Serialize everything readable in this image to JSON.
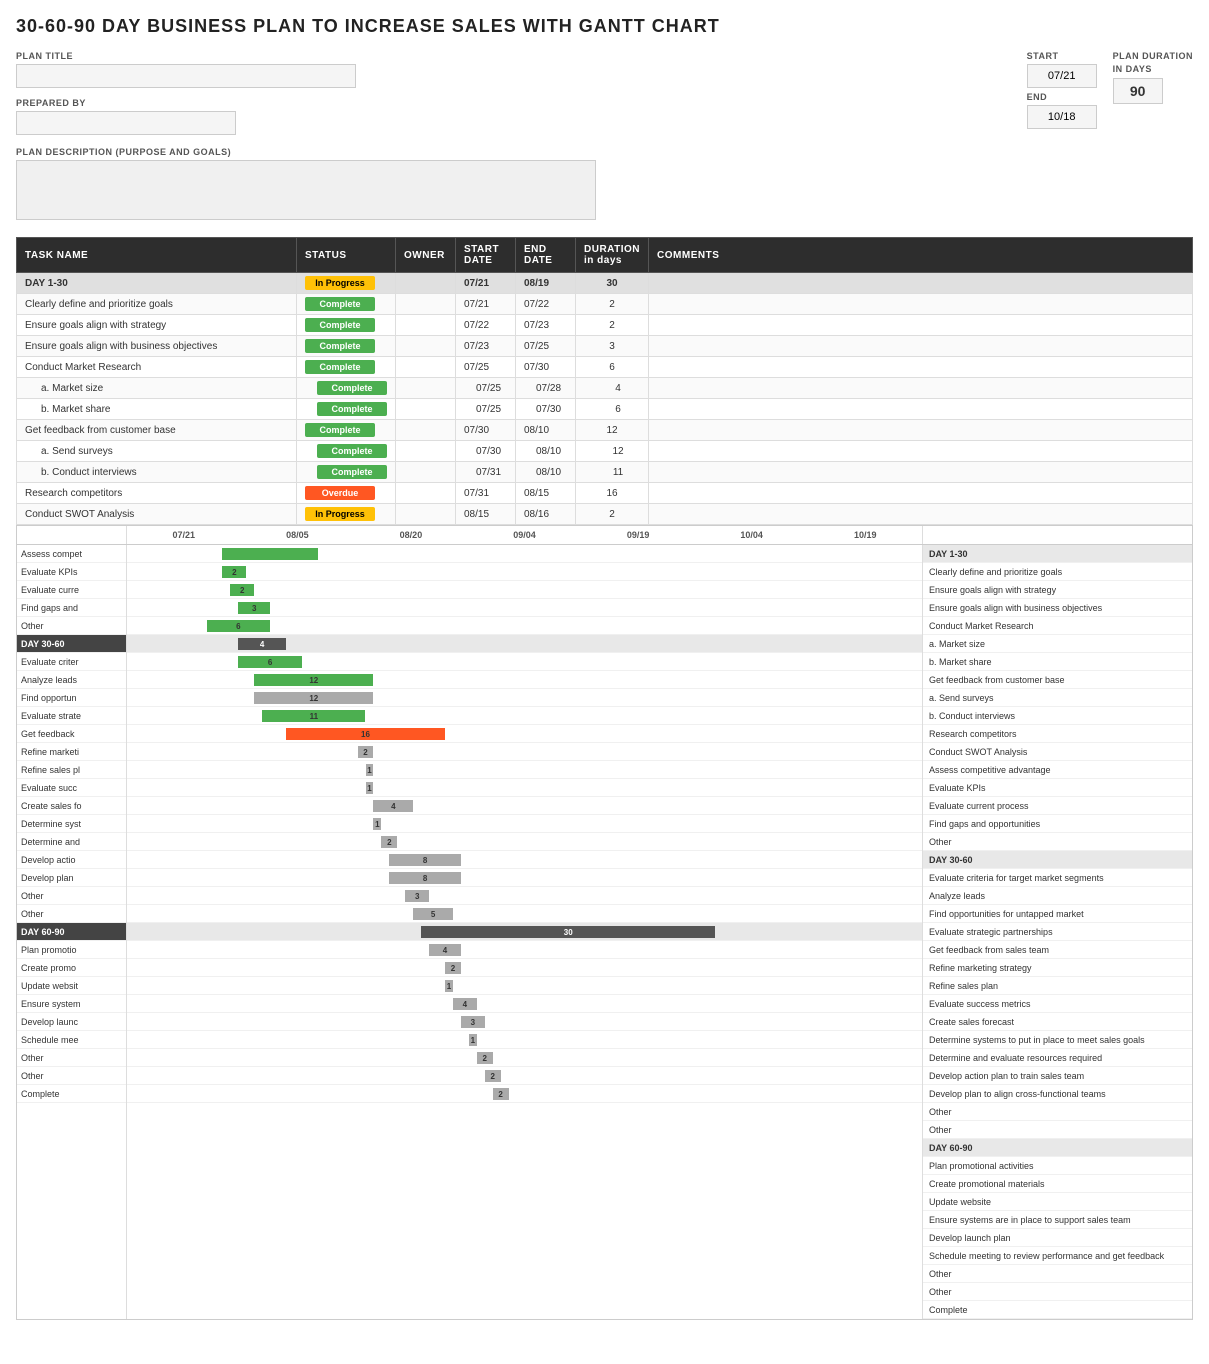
{
  "title": "30-60-90 DAY BUSINESS PLAN TO INCREASE SALES WITH GANTT CHART",
  "form": {
    "plan_title_label": "PLAN TITLE",
    "plan_title_value": "",
    "prepared_by_label": "PREPARED BY",
    "prepared_by_value": "",
    "start_label": "START",
    "start_value": "07/21",
    "end_label": "END",
    "end_value": "10/18",
    "plan_duration_label": "PLAN DURATION",
    "plan_duration_unit": "in days",
    "plan_duration_value": "90",
    "description_label": "PLAN DESCRIPTION (PURPOSE AND GOALS)",
    "description_value": ""
  },
  "table_headers": {
    "task_name": "TASK NAME",
    "status": "STATUS",
    "owner": "OWNER",
    "start_date": "START DATE",
    "end_date": "END DATE",
    "duration": "DURATION in days",
    "comments": "COMMENTS"
  },
  "tasks": [
    {
      "name": "DAY 1-30",
      "status": "In Progress",
      "status_type": "inprogress",
      "owner": "",
      "start": "07/21",
      "end": "08/19",
      "duration": "30",
      "comments": "",
      "level": "day"
    },
    {
      "name": "Clearly define and prioritize goals",
      "status": "Complete",
      "status_type": "complete",
      "owner": "",
      "start": "07/21",
      "end": "07/22",
      "duration": "2",
      "comments": "",
      "level": "task"
    },
    {
      "name": "Ensure goals align with strategy",
      "status": "Complete",
      "status_type": "complete",
      "owner": "",
      "start": "07/22",
      "end": "07/23",
      "duration": "2",
      "comments": "",
      "level": "task"
    },
    {
      "name": "Ensure goals align with business objectives",
      "status": "Complete",
      "status_type": "complete",
      "owner": "",
      "start": "07/23",
      "end": "07/25",
      "duration": "3",
      "comments": "",
      "level": "task"
    },
    {
      "name": "Conduct Market Research",
      "status": "Complete",
      "status_type": "complete",
      "owner": "",
      "start": "07/25",
      "end": "07/30",
      "duration": "6",
      "comments": "",
      "level": "task"
    },
    {
      "name": "a. Market size",
      "status": "Complete",
      "status_type": "complete",
      "owner": "",
      "start": "07/25",
      "end": "07/28",
      "duration": "4",
      "comments": "",
      "level": "sub"
    },
    {
      "name": "b. Market share",
      "status": "Complete",
      "status_type": "complete",
      "owner": "",
      "start": "07/25",
      "end": "07/30",
      "duration": "6",
      "comments": "",
      "level": "sub"
    },
    {
      "name": "Get feedback from customer base",
      "status": "Complete",
      "status_type": "complete",
      "owner": "",
      "start": "07/30",
      "end": "08/10",
      "duration": "12",
      "comments": "",
      "level": "task"
    },
    {
      "name": "a. Send surveys",
      "status": "Complete",
      "status_type": "complete",
      "owner": "",
      "start": "07/30",
      "end": "08/10",
      "duration": "12",
      "comments": "",
      "level": "sub"
    },
    {
      "name": "b. Conduct interviews",
      "status": "Complete",
      "status_type": "complete",
      "owner": "",
      "start": "07/31",
      "end": "08/10",
      "duration": "11",
      "comments": "",
      "level": "sub"
    },
    {
      "name": "Research competitors",
      "status": "Overdue",
      "status_type": "overdue",
      "owner": "",
      "start": "07/31",
      "end": "08/15",
      "duration": "16",
      "comments": "",
      "level": "task"
    },
    {
      "name": "Conduct SWOT Analysis",
      "status": "In Progress",
      "status_type": "inprogress",
      "owner": "",
      "start": "08/15",
      "end": "08/16",
      "duration": "2",
      "comments": "",
      "level": "task"
    }
  ],
  "gantt": {
    "time_labels": [
      "07/21",
      "08/05",
      "08/20",
      "09/04",
      "09/19",
      "10/04",
      "10/19"
    ],
    "rows": [
      {
        "label": "Assess compet",
        "type": "task",
        "bar_start_pct": 12,
        "bar_width_pct": 12,
        "bar_value": null,
        "bar_type": "complete"
      },
      {
        "label": "Evaluate KPIs",
        "type": "task",
        "bar_start_pct": 12,
        "bar_width_pct": 3,
        "bar_value": "2",
        "bar_type": "complete"
      },
      {
        "label": "Evaluate curre",
        "type": "task",
        "bar_start_pct": 13,
        "bar_width_pct": 3,
        "bar_value": "2",
        "bar_type": "complete"
      },
      {
        "label": "Find gaps and",
        "type": "task",
        "bar_start_pct": 14,
        "bar_width_pct": 4,
        "bar_value": "3",
        "bar_type": "complete"
      },
      {
        "label": "Other",
        "type": "task",
        "bar_start_pct": 10,
        "bar_width_pct": 8,
        "bar_value": "6",
        "bar_type": "complete"
      },
      {
        "label": "DAY 30-60",
        "type": "day",
        "bar_start_pct": 14,
        "bar_width_pct": 6,
        "bar_value": "4",
        "bar_type": "day"
      },
      {
        "label": "Evaluate criter",
        "type": "task",
        "bar_start_pct": 14,
        "bar_width_pct": 8,
        "bar_value": "6",
        "bar_type": "complete"
      },
      {
        "label": "Analyze leads",
        "type": "task",
        "bar_start_pct": 16,
        "bar_width_pct": 15,
        "bar_value": "12",
        "bar_type": "complete"
      },
      {
        "label": "Find opportun",
        "type": "task",
        "bar_start_pct": 16,
        "bar_width_pct": 15,
        "bar_value": "12",
        "bar_type": "inprogress"
      },
      {
        "label": "Evaluate strate",
        "type": "task",
        "bar_start_pct": 17,
        "bar_width_pct": 13,
        "bar_value": "11",
        "bar_type": "complete"
      },
      {
        "label": "Get feedback",
        "type": "task",
        "bar_start_pct": 20,
        "bar_width_pct": 20,
        "bar_value": "16",
        "bar_type": "overdue"
      },
      {
        "label": "Refine marketi",
        "type": "task",
        "bar_start_pct": 29,
        "bar_width_pct": 2,
        "bar_value": "2",
        "bar_type": "inprogress"
      },
      {
        "label": "Refine sales pl",
        "type": "task",
        "bar_start_pct": 30,
        "bar_width_pct": 1,
        "bar_value": "1",
        "bar_type": "inprogress"
      },
      {
        "label": "Evaluate succ",
        "type": "task",
        "bar_start_pct": 30,
        "bar_width_pct": 1,
        "bar_value": "1",
        "bar_type": "inprogress"
      },
      {
        "label": "Create sales fo",
        "type": "task",
        "bar_start_pct": 31,
        "bar_width_pct": 5,
        "bar_value": "4",
        "bar_type": "inprogress"
      },
      {
        "label": "Determine syst",
        "type": "task",
        "bar_start_pct": 31,
        "bar_width_pct": 1,
        "bar_value": "1",
        "bar_type": "inprogress"
      },
      {
        "label": "Determine and",
        "type": "task",
        "bar_start_pct": 32,
        "bar_width_pct": 2,
        "bar_value": "2",
        "bar_type": "inprogress"
      },
      {
        "label": "Develop actio",
        "type": "task",
        "bar_start_pct": 33,
        "bar_width_pct": 9,
        "bar_value": "8",
        "bar_type": "inprogress"
      },
      {
        "label": "Develop plan",
        "type": "task",
        "bar_start_pct": 33,
        "bar_width_pct": 9,
        "bar_value": "8",
        "bar_type": "inprogress"
      },
      {
        "label": "Other",
        "type": "task",
        "bar_start_pct": 35,
        "bar_width_pct": 3,
        "bar_value": "3",
        "bar_type": "inprogress"
      },
      {
        "label": "Other",
        "type": "task",
        "bar_start_pct": 36,
        "bar_width_pct": 5,
        "bar_value": "5",
        "bar_type": "inprogress"
      },
      {
        "label": "DAY 60-90",
        "type": "day",
        "bar_start_pct": 37,
        "bar_width_pct": 37,
        "bar_value": "30",
        "bar_type": "day"
      },
      {
        "label": "Plan promotio",
        "type": "task",
        "bar_start_pct": 38,
        "bar_width_pct": 4,
        "bar_value": "4",
        "bar_type": "inprogress"
      },
      {
        "label": "Create promo",
        "type": "task",
        "bar_start_pct": 40,
        "bar_width_pct": 2,
        "bar_value": "2",
        "bar_type": "inprogress"
      },
      {
        "label": "Update websit",
        "type": "task",
        "bar_start_pct": 40,
        "bar_width_pct": 1,
        "bar_value": "1",
        "bar_type": "inprogress"
      },
      {
        "label": "Ensure system",
        "type": "task",
        "bar_start_pct": 41,
        "bar_width_pct": 3,
        "bar_value": "4",
        "bar_type": "inprogress"
      },
      {
        "label": "Develop launc",
        "type": "task",
        "bar_start_pct": 42,
        "bar_width_pct": 3,
        "bar_value": "3",
        "bar_type": "inprogress"
      },
      {
        "label": "Schedule mee",
        "type": "task",
        "bar_start_pct": 43,
        "bar_width_pct": 1,
        "bar_value": "1",
        "bar_type": "inprogress"
      },
      {
        "label": "Other",
        "type": "task",
        "bar_start_pct": 44,
        "bar_width_pct": 2,
        "bar_value": "2",
        "bar_type": "inprogress"
      },
      {
        "label": "Other",
        "type": "task",
        "bar_start_pct": 45,
        "bar_width_pct": 2,
        "bar_value": "2",
        "bar_type": "inprogress"
      },
      {
        "label": "Complete",
        "type": "task",
        "bar_start_pct": 46,
        "bar_width_pct": 2,
        "bar_value": "2",
        "bar_type": "inprogress"
      }
    ],
    "legend": [
      "DAY 1-30",
      "Clearly define and prioritize goals",
      "Ensure goals align with strategy",
      "Ensure goals align with business objectives",
      "Conduct Market Research",
      "a. Market size",
      "b. Market share",
      "Get feedback from customer base",
      "a. Send surveys",
      "b. Conduct interviews",
      "Research competitors",
      "Conduct SWOT Analysis",
      "Assess competitive advantage",
      "Evaluate KPIs",
      "Evaluate current process",
      "Find gaps and opportunities",
      "Other",
      "DAY 30-60",
      "Evaluate criteria for target market segments",
      "Analyze leads",
      "Find opportunities for untapped market",
      "Evaluate strategic partnerships",
      "Get feedback from sales team",
      "Refine marketing strategy",
      "Refine sales plan",
      "Evaluate success metrics",
      "Create sales forecast",
      "Determine systems to put in place to meet sales goals",
      "Determine and evaluate resources required",
      "Develop action plan to train sales team",
      "Develop plan to align cross-functional teams",
      "Other",
      "Other",
      "DAY 60-90",
      "Plan promotional activities",
      "Create promotional materials",
      "Update website",
      "Ensure systems are in place to support sales team",
      "Develop launch plan",
      "Schedule meeting to review performance and get feedback",
      "Other",
      "Other",
      "Complete"
    ]
  }
}
